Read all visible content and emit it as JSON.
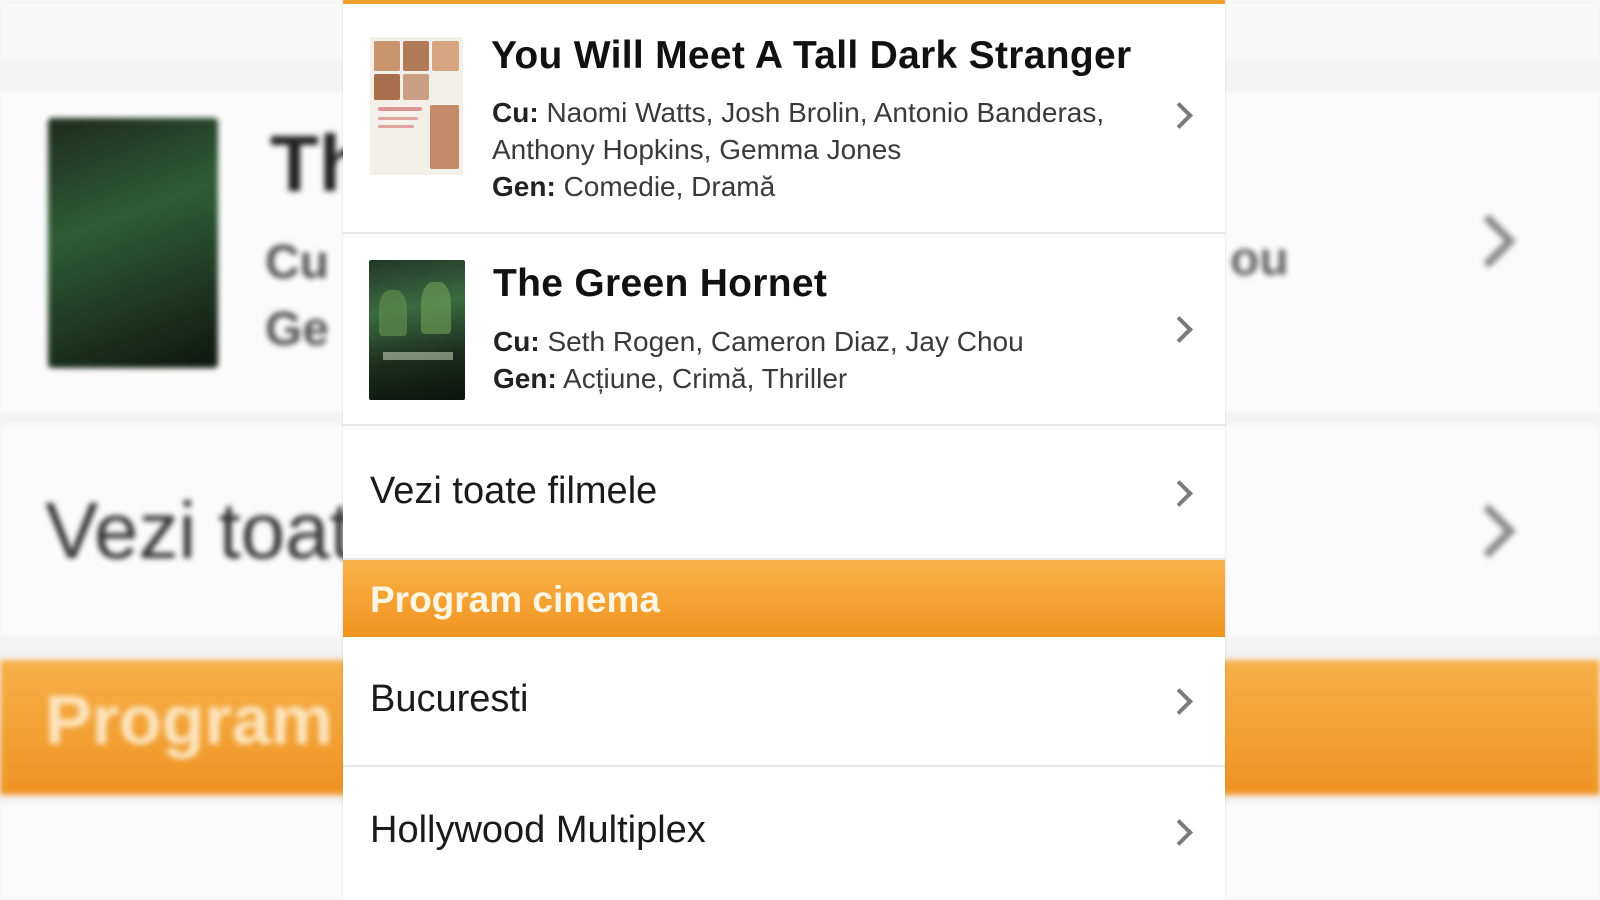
{
  "background": {
    "title_fragment": "Th",
    "cu_fragment": "Cu",
    "gen_fragment": "Ge",
    "cast_fragment": "ou",
    "link_fragment": "Vezi toat",
    "section_fragment": "Program",
    "colors": {
      "accent": "#f1941f"
    }
  },
  "movies": [
    {
      "title": "You Will Meet A Tall Dark Stranger",
      "cast_label": "Cu:",
      "cast": "Naomi Watts, Josh Brolin, Antonio Banderas, Anthony Hopkins, Gemma Jones",
      "genre_label": "Gen:",
      "genre": "Comedie, Dramă",
      "poster_icon": "movie-poster"
    },
    {
      "title": "The Green Hornet",
      "cast_label": "Cu:",
      "cast": "Seth Rogen, Cameron Diaz, Jay Chou",
      "genre_label": "Gen:",
      "genre": "Acțiune, Crimă, Thriller",
      "poster_icon": "movie-poster"
    }
  ],
  "all_movies_link": "Vezi toate filmele",
  "section": {
    "title": "Program cinema"
  },
  "cinema_items": [
    "Bucuresti",
    "Hollywood Multiplex"
  ],
  "icons": {
    "row_arrow": "chevron-right-icon"
  },
  "colors": {
    "header_orange": "#f1941f",
    "header_text": "#fff5e3",
    "divider": "#e6e6e6"
  }
}
